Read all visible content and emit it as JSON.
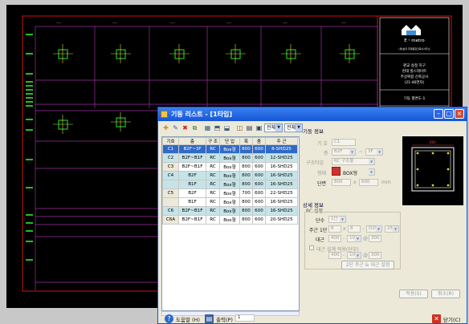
{
  "cad": {
    "logo_line1": "E・metro",
    "logo_line2": "(재)삼우·주형종합건축사사무소",
    "proj_line1": "판교 송정 지구",
    "proj_line2": "현대 힐스테이트",
    "proj_line3": "주상복합 신축공사",
    "proj_line4": "(21-46연차)",
    "drawing_name": "기둥 평면도-1",
    "note": "ДИВОБЕЛ ЛОДН",
    "colors": {
      "frame": "#d01010",
      "line": "#a030a0",
      "column": "#20c020",
      "node": "#e0e040"
    }
  },
  "window": {
    "title": "기둥 리스트 - [1타입]",
    "toolbar": {
      "icons": [
        "add-icon",
        "edit-icon",
        "delete-icon",
        "copy-icon",
        "grid-icon",
        "import-icon",
        "export-icon",
        "view-icon",
        "print-icon"
      ],
      "filter1": "전체",
      "filter2": "전체"
    },
    "table": {
      "headers": [
        "기호",
        "층",
        "구 조",
        "단 입",
        "폭",
        "춤",
        "주 근"
      ],
      "rows": [
        {
          "code": "C1",
          "floor": "B2F~3F",
          "struct": "RC",
          "shape": "Box형",
          "w": "800",
          "h": "600",
          "rebar": "8-SHD25",
          "selected": true
        },
        {
          "code": "C2",
          "floor": "B2F~B1F",
          "struct": "RC",
          "shape": "Box형",
          "w": "800",
          "h": "600",
          "rebar": "12-SHD25",
          "alt": true
        },
        {
          "code": "C3",
          "floor": "B2F~B1F",
          "struct": "RC",
          "shape": "Box형",
          "w": "800",
          "h": "600",
          "rebar": "16-SHD25"
        },
        {
          "code": "C4",
          "floor": "B2F",
          "struct": "RC",
          "shape": "Box형",
          "w": "800",
          "h": "600",
          "rebar": "16-SHD25",
          "alt": true
        },
        {
          "code": "",
          "floor": "B1F",
          "struct": "RC",
          "shape": "Box형",
          "w": "800",
          "h": "600",
          "rebar": "16-SHD25",
          "alt": true
        },
        {
          "code": "C5",
          "floor": "B2F",
          "struct": "RC",
          "shape": "Box형",
          "w": "700",
          "h": "600",
          "rebar": "22-SHD25"
        },
        {
          "code": "",
          "floor": "B1F",
          "struct": "RC",
          "shape": "Box형",
          "w": "800",
          "h": "600",
          "rebar": "16-SHD25"
        },
        {
          "code": "C6",
          "floor": "B2F~B1F",
          "struct": "RC",
          "shape": "Box형",
          "w": "800",
          "h": "600",
          "rebar": "16-SHD25",
          "alt": true
        },
        {
          "code": "C6A",
          "floor": "B2F~B1F",
          "struct": "RC",
          "shape": "Box형",
          "w": "800",
          "h": "600",
          "rebar": "20-SHD25"
        }
      ]
    },
    "info": {
      "section_title": "기둥 정보",
      "code_label": "기 호",
      "code_value": "C1",
      "floor_label": "층",
      "floor_from": "B2F",
      "floor_to": "3F",
      "struct_label": "구조타입",
      "struct_value": "RC 구조물",
      "shape_label": "형태",
      "shape_value": "BOX형",
      "section_label": "단면",
      "width": "800",
      "depth": "600",
      "unit": "mm"
    },
    "detail": {
      "section_title": "상세 정보",
      "group_title": "RC 설정",
      "stage_label": "단수",
      "stage_value": "1단",
      "main_label": "주근 1단",
      "main_v1": "8",
      "main_v2": "8",
      "main_v3": "D25",
      "main_v4": "25",
      "tie_label": "대근",
      "tie_v1": "400",
      "tie_v2": "10",
      "tie_v3": "300",
      "check_label": "대근 설계 적용(단부)",
      "chk_v1": "400",
      "chk_v2": "10",
      "chk_v3": "300",
      "btn_rebar": "2단 주근 & 대근 설정"
    },
    "preview_dim": "800",
    "buttons": {
      "apply": "적용(S)",
      "cancel": "취소(R)"
    },
    "status": {
      "help": "도움말 (H)",
      "print": "출력(P)",
      "print_value": "1",
      "close": "닫기(C)"
    }
  }
}
